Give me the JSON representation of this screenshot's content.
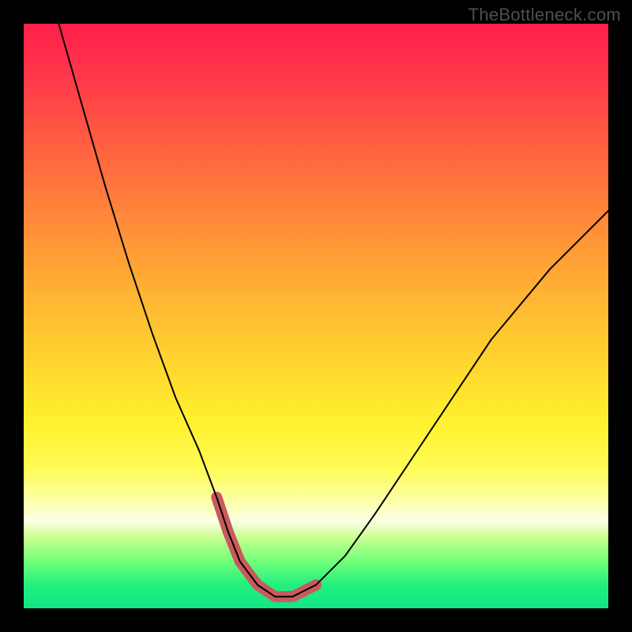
{
  "watermark": "TheBottleneck.com",
  "chart_data": {
    "type": "line",
    "title": "",
    "xlabel": "",
    "ylabel": "",
    "xlim": [
      0,
      100
    ],
    "ylim": [
      0,
      100
    ],
    "grid": false,
    "series": [
      {
        "name": "bottleneck-curve",
        "x": [
          6,
          10,
          14,
          18,
          22,
          26,
          30,
          33,
          35,
          37,
          40,
          43,
          46,
          50,
          55,
          60,
          66,
          72,
          80,
          90,
          100
        ],
        "y": [
          100,
          86,
          72,
          59,
          47,
          36,
          27,
          19,
          13,
          8,
          4,
          2,
          2,
          4,
          9,
          16,
          25,
          34,
          46,
          58,
          68
        ]
      }
    ],
    "accent_region": {
      "name": "highlighted-minimum",
      "x": [
        33,
        35,
        37,
        40,
        43,
        46,
        50
      ],
      "y": [
        19,
        13,
        8,
        4,
        2,
        2,
        4
      ]
    },
    "background_gradient": {
      "direction": "vertical",
      "stops": [
        {
          "pos": 0.0,
          "color": "#ff1e4a"
        },
        {
          "pos": 0.34,
          "color": "#ff8b39"
        },
        {
          "pos": 0.58,
          "color": "#ffd52f"
        },
        {
          "pos": 0.82,
          "color": "#fdffae"
        },
        {
          "pos": 0.88,
          "color": "#c6ff8e"
        },
        {
          "pos": 1.0,
          "color": "#12e586"
        }
      ]
    }
  }
}
